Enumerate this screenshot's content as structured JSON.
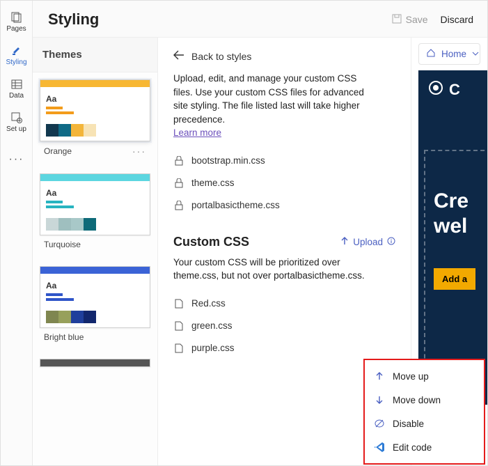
{
  "nav": {
    "items": [
      {
        "label": "Pages",
        "icon": "pages-icon"
      },
      {
        "label": "Styling",
        "icon": "brush-icon",
        "selected": true
      },
      {
        "label": "Data",
        "icon": "data-icon"
      },
      {
        "label": "Set up",
        "icon": "setup-icon"
      }
    ]
  },
  "header": {
    "title": "Styling",
    "save": "Save",
    "discard": "Discard"
  },
  "themes": {
    "heading": "Themes",
    "list": [
      {
        "name": "Orange",
        "topColor": "#f7b733",
        "accent": "#f39c1b",
        "swatches": [
          "#12384f",
          "#0f6a86",
          "#f3b53a",
          "#f7e3b5"
        ],
        "selected": true
      },
      {
        "name": "Turquoise",
        "topColor": "#5cd6e0",
        "accent": "#28b4c0",
        "swatches": [
          "#c9d7d8",
          "#9fbfbf",
          "#a8c8c8",
          "#0e6a78"
        ]
      },
      {
        "name": "Bright blue",
        "topColor": "#3b63d6",
        "accent": "#2f55c9",
        "swatches": [
          "#7f8650",
          "#97a05b",
          "#1f3f9c",
          "#12276d"
        ]
      }
    ]
  },
  "styles": {
    "back": "Back to styles",
    "desc": "Upload, edit, and manage your custom CSS files. Use your custom CSS files for advanced site styling. The file listed last will take higher precedence.",
    "learn": "Learn more",
    "locked_files": [
      "bootstrap.min.css",
      "theme.css",
      "portalbasictheme.css"
    ],
    "custom_heading": "Custom CSS",
    "upload_label": "Upload",
    "custom_note": "Your custom CSS will be prioritized over theme.css, but not over portalbasictheme.css.",
    "custom_files": [
      "Red.css",
      "green.css",
      "purple.css"
    ]
  },
  "preview": {
    "home": "Home",
    "brand_initial": "C",
    "hero_line1": "Cre",
    "hero_line2": "wel",
    "cta": "Add a"
  },
  "context_menu": {
    "items": [
      {
        "label": "Move up",
        "icon": "arrow-up-icon"
      },
      {
        "label": "Move down",
        "icon": "arrow-down-icon"
      },
      {
        "label": "Disable",
        "icon": "disable-icon"
      },
      {
        "label": "Edit code",
        "icon": "vscode-icon"
      }
    ]
  }
}
